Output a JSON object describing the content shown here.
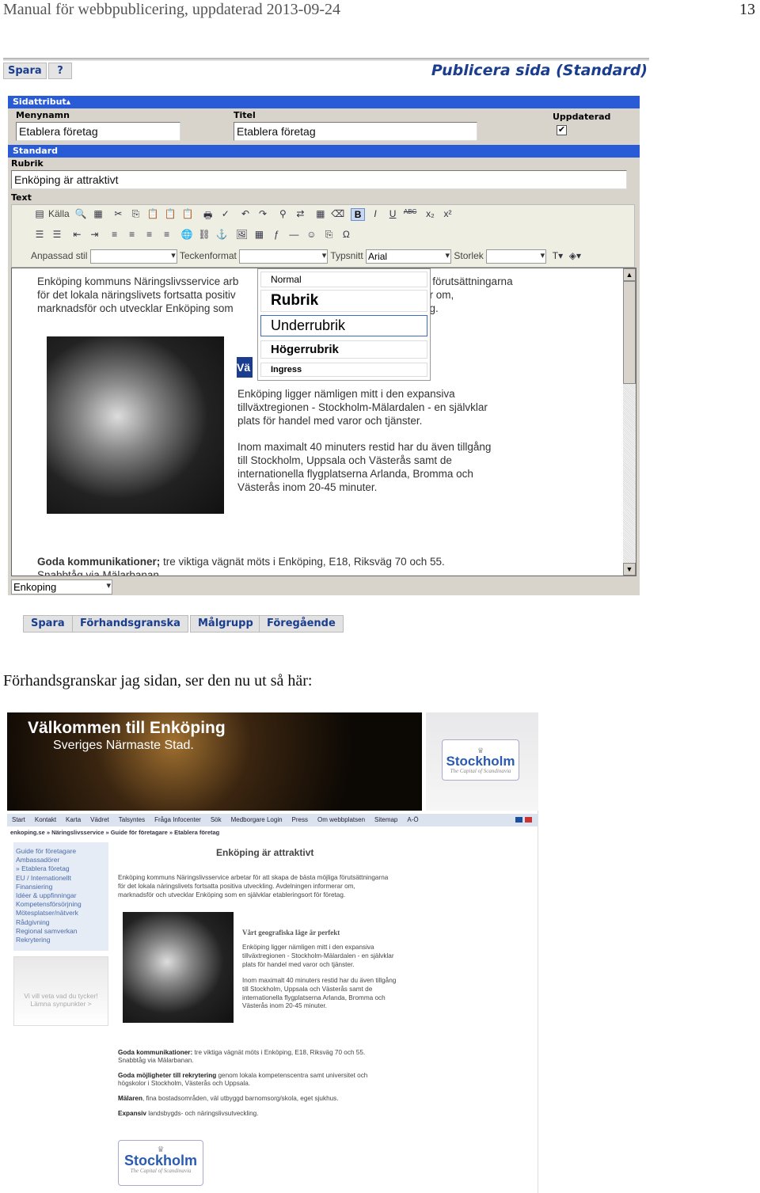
{
  "document": {
    "header": "Manual för webbpublicering, uppdaterad 2013-09-24",
    "page_number": "13",
    "caption": "Förhandsgranskar jag sidan, ser den nu ut så här:"
  },
  "editor": {
    "top_buttons": [
      "Spara",
      "?"
    ],
    "title": "Publicera sida (Standard)",
    "section_attributes": "Sidattribut▴",
    "menynamn_label": "Menynamn",
    "menynamn_value": "Etablera företag",
    "titel_label": "Titel",
    "titel_value": "Etablera företag",
    "uppdaterad_label": "Uppdaterad",
    "uppdaterad_checked": true,
    "section_standard": "Standard",
    "rubrik_label": "Rubrik",
    "rubrik_value": "Enköping är attraktivt",
    "text_label": "Text",
    "toolbar": {
      "source_label": "Källa",
      "custom_style_label": "Anpassad stil",
      "custom_style_value": "",
      "format_label": "Teckenformat",
      "format_value": "",
      "font_label": "Typsnitt",
      "font_value": "Arial",
      "size_label": "Storlek",
      "size_value": ""
    },
    "format_dropdown": [
      "Normal",
      "Rubrik",
      "Underrubrik",
      "Högerrubrik",
      "Ingress"
    ],
    "format_dropdown_highlighted": "Underrubrik",
    "content": {
      "intro": [
        "Enköping kommuns Näringslivsservice arb",
        "för det lokala näringslivets fortsatta positiv",
        "marknadsför och utvecklar Enköping som"
      ],
      "intro_right": [
        "a förutsättningarna",
        "ar om,",
        "ag."
      ],
      "heading_fragment": "Vä",
      "para1": [
        "Enköping ligger nämligen mitt i den expansiva",
        "tillväxtregionen - Stockholm-Mälardalen - en självklar",
        "plats för handel med varor och tjänster."
      ],
      "para2": [
        "Inom maximalt 40 minuters restid har du även tillgång",
        "till Stockholm, Uppsala och Västerås samt de",
        "internationella flygplatserna Arlanda, Bromma och",
        "Västerås inom 20-45 minuter."
      ],
      "comm_bold": "Goda kommunikationer;",
      "comm_text": " tre viktiga vägnät möts i Enköping, E18, Riksväg 70 och 55.",
      "comm_line2": "Snabbtåg via Mälarbanan."
    },
    "template_select": "Enkoping",
    "bottom_buttons": [
      "Spara",
      "Förhandsgranska",
      "Målgrupp",
      "Föregående"
    ]
  },
  "preview": {
    "banner_title": "Välkommen till Enköping",
    "banner_subtitle": "Sveriges Närmaste Stad.",
    "logo_text": "Stockholm",
    "logo_tagline": "The Capital of Scandinavia",
    "nav": [
      "Start",
      "Kontakt",
      "Karta",
      "Vädret",
      "Talsyntes",
      "Fråga Infocenter",
      "Sök",
      "Medborgare Login",
      "Press",
      "Om webbplatsen",
      "Sitemap",
      "A-Ö"
    ],
    "breadcrumb": "enkoping.se » Näringslivsservice » Guide för företagare » Etablera företag",
    "menu": [
      "Guide för företagare",
      "Ambassadörer",
      "» Etablera företag",
      "EU / Internationellt",
      "Finansiering",
      "Idéer & uppfinningar",
      "Kompetensförsörjning",
      "Mötesplatser/nätverk",
      "Rådgivning",
      "Regional samverkan",
      "Rekrytering"
    ],
    "feedback": "Vi vill veta vad du tycker! Lämna synpunkter >",
    "heading": "Enköping är attraktivt",
    "intro": [
      "Enköping kommuns Näringslivsservice arbetar för att skapa de bästa möjliga förutsättningarna",
      "för det lokala näringslivets fortsatta positiva utveckling. Avdelningen informerar om,",
      "marknadsför och utvecklar Enköping som en självklar etableringsort för företag."
    ],
    "subheading": "Vårt geografiska läge är perfekt",
    "para1": [
      "Enköping ligger nämligen mitt i den expansiva",
      "tillväxtregionen - Stockholm-Mälardalen - en självklar",
      "plats för handel med varor och tjänster."
    ],
    "para2": [
      "Inom maximalt 40 minuters restid har du även tillgång",
      "till Stockholm, Uppsala och Västerås samt de",
      "internationella flygplatserna Arlanda, Bromma och",
      "Västerås inom 20-45 minuter."
    ],
    "b1": "Goda kommunikationer:",
    "t1": " tre viktiga vägnät möts i Enköping, E18, Riksväg 70 och 55.",
    "t1b": "Snabbtåg via Mälarbanan.",
    "b2": "Goda möjligheter till rekrytering",
    "t2": " genom lokala kompetenscentra samt universitet och",
    "t2b": "högskolor i Stockholm, Västerås och Uppsala.",
    "b3": "Mälaren",
    "t3": ", fina bostadsområden, väl utbyggd barnomsorg/skola, eget sjukhus.",
    "b4": "Expansiv",
    "t4": " landsbygds- och näringslivsutveckling."
  },
  "colors": {
    "header_bar": "#2a5bd7",
    "button_text": "#1a3d8f",
    "menu_link": "#4a6aa8"
  }
}
